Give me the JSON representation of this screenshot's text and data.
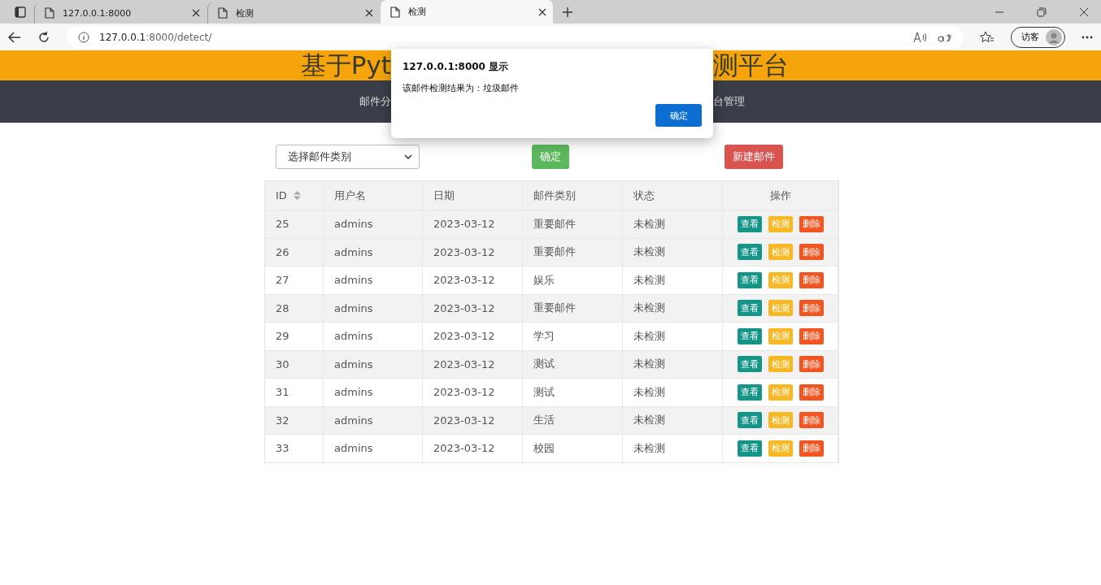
{
  "browser": {
    "tabs": [
      {
        "title": "127.0.0.1:8000",
        "selected": false
      },
      {
        "title": "检测",
        "selected": false
      },
      {
        "title": "检测",
        "selected": true
      }
    ],
    "address": {
      "host": "127.0.0.1",
      "rest": ":8000/detect/"
    },
    "profile": "访客"
  },
  "header": {
    "title_left": "基于Pyt",
    "title_right": "测平台"
  },
  "nav": {
    "left": "邮件分",
    "right": "台管理"
  },
  "toolbar": {
    "select_placeholder": "选择邮件类别",
    "confirm": "确定",
    "new_mail": "新建邮件"
  },
  "table": {
    "columns": [
      {
        "label": "ID",
        "sortable": true
      },
      {
        "label": "用户名",
        "sortable": false
      },
      {
        "label": "日期",
        "sortable": false
      },
      {
        "label": "邮件类别",
        "sortable": false
      },
      {
        "label": "状态",
        "sortable": false
      },
      {
        "label": "操作",
        "sortable": false
      }
    ],
    "rows": [
      {
        "id": "25",
        "user": "admins",
        "date": "2023-03-12",
        "category": "重要邮件",
        "status": "未检测",
        "shaded": true,
        "actions": [
          {
            "label": "查看",
            "kind": "view"
          },
          {
            "label": "检测",
            "kind": "detect"
          },
          {
            "label": "删除",
            "kind": "delete"
          }
        ]
      },
      {
        "id": "26",
        "user": "admins",
        "date": "2023-03-12",
        "category": "重要邮件",
        "status": "未检测",
        "shaded": true,
        "actions": [
          {
            "label": "查看",
            "kind": "view"
          },
          {
            "label": "检测",
            "kind": "detect"
          },
          {
            "label": "删除",
            "kind": "delete"
          }
        ]
      },
      {
        "id": "27",
        "user": "admins",
        "date": "2023-03-12",
        "category": "娱乐",
        "status": "未检测",
        "shaded": false,
        "actions": [
          {
            "label": "查看",
            "kind": "view"
          },
          {
            "label": "检测",
            "kind": "detect"
          },
          {
            "label": "删除",
            "kind": "delete"
          }
        ]
      },
      {
        "id": "28",
        "user": "admins",
        "date": "2023-03-12",
        "category": "重要邮件",
        "status": "未检测",
        "shaded": true,
        "actions": [
          {
            "label": "查看",
            "kind": "view"
          },
          {
            "label": "检测",
            "kind": "detect"
          },
          {
            "label": "删除",
            "kind": "delete"
          }
        ]
      },
      {
        "id": "29",
        "user": "admins",
        "date": "2023-03-12",
        "category": "学习",
        "status": "未检测",
        "shaded": false,
        "actions": [
          {
            "label": "查看",
            "kind": "view"
          },
          {
            "label": "检测",
            "kind": "detect"
          },
          {
            "label": "删除",
            "kind": "delete"
          }
        ]
      },
      {
        "id": "30",
        "user": "admins",
        "date": "2023-03-12",
        "category": "测试",
        "status": "未检测",
        "shaded": true,
        "actions": [
          {
            "label": "查看",
            "kind": "view"
          },
          {
            "label": "检测",
            "kind": "detect"
          },
          {
            "label": "删除",
            "kind": "delete"
          }
        ]
      },
      {
        "id": "31",
        "user": "admins",
        "date": "2023-03-12",
        "category": "测试",
        "status": "未检测",
        "shaded": false,
        "actions": [
          {
            "label": "查看",
            "kind": "view"
          },
          {
            "label": "检测",
            "kind": "detect"
          },
          {
            "label": "删除",
            "kind": "delete"
          }
        ]
      },
      {
        "id": "32",
        "user": "admins",
        "date": "2023-03-12",
        "category": "生活",
        "status": "未检测",
        "shaded": true,
        "actions": [
          {
            "label": "查看",
            "kind": "view"
          },
          {
            "label": "检测",
            "kind": "detect"
          },
          {
            "label": "删除",
            "kind": "delete"
          }
        ]
      },
      {
        "id": "33",
        "user": "admins",
        "date": "2023-03-12",
        "category": "校园",
        "status": "未检测",
        "shaded": false,
        "actions": [
          {
            "label": "查看",
            "kind": "view"
          },
          {
            "label": "检测",
            "kind": "detect"
          },
          {
            "label": "删除",
            "kind": "delete"
          }
        ]
      }
    ]
  },
  "dialog": {
    "title": "127.0.0.1:8000 显示",
    "message": "该邮件检测结果为：垃圾邮件",
    "ok": "确定"
  }
}
